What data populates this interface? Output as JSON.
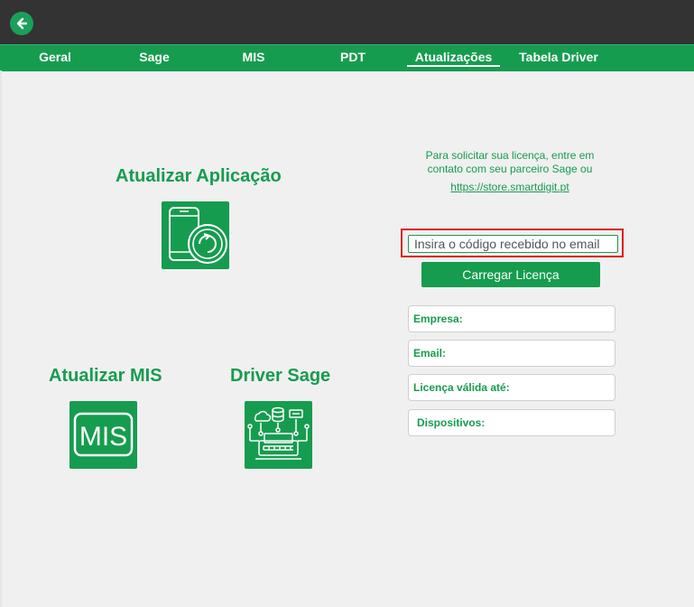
{
  "header": {
    "back_icon": "arrow-left-icon"
  },
  "tabs": [
    {
      "label": "Geral"
    },
    {
      "label": "Sage"
    },
    {
      "label": "MIS"
    },
    {
      "label": "PDT"
    },
    {
      "label": "Atualizações",
      "active": true
    },
    {
      "label": "Tabela Driver"
    }
  ],
  "sections": {
    "update_app": {
      "title": "Atualizar Aplicação",
      "icon": "phone-refresh-icon"
    },
    "update_mis": {
      "title": "Atualizar MIS",
      "icon_text": "MIS"
    },
    "driver_sage": {
      "title": "Driver Sage",
      "icon": "network-printer-icon"
    }
  },
  "license": {
    "info_text": "Para solicitar sua licença, entre em contato com seu parceiro Sage ou",
    "store_link": "https://store.smartdigit.pt",
    "code_placeholder": "Insira o código recebido no email",
    "load_button": "Carregar Licença",
    "fields": {
      "empresa": "Empresa:",
      "email": "Email:",
      "validade": "Licença válida até:",
      "dispositivos": "Dispositivos:"
    }
  },
  "colors": {
    "brand_green": "#169c4f",
    "topbar": "#333333",
    "highlight": "#e01b1b"
  }
}
